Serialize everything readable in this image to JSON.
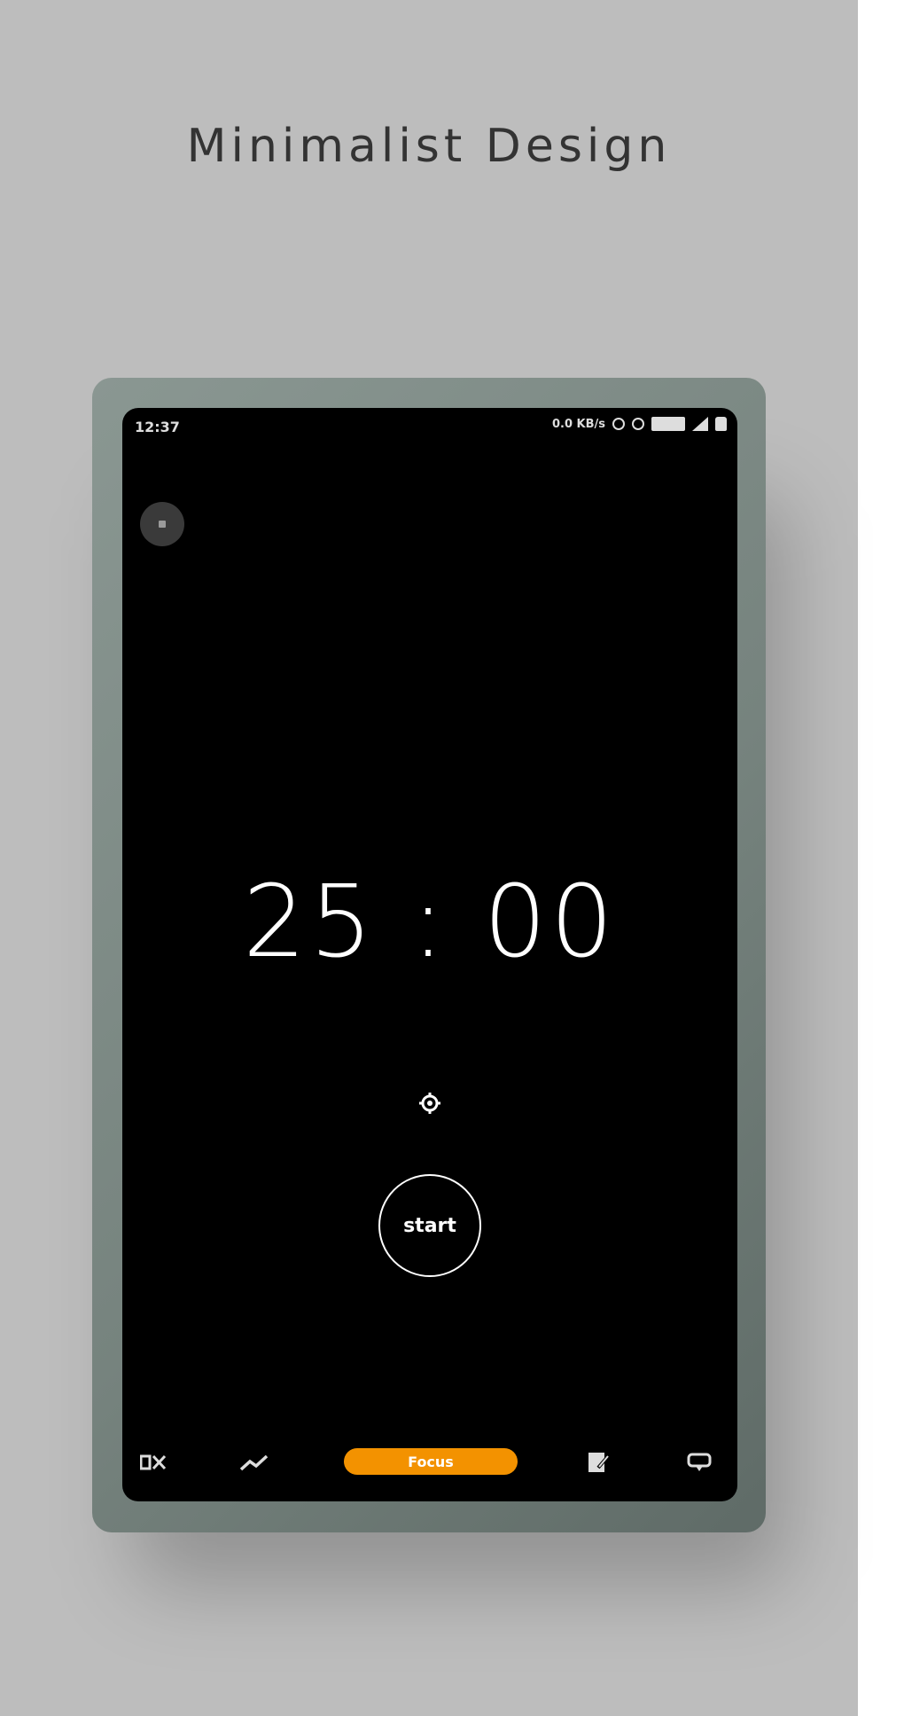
{
  "headline": "Minimalist Design",
  "status_bar": {
    "time": "12:37",
    "speed": "0.0 KB/s",
    "battery_label": ""
  },
  "timer": {
    "display": "25 : 00"
  },
  "controls": {
    "start_label": "start"
  },
  "tabbar": {
    "focus_label": "Focus",
    "icons": [
      "grid-icon",
      "trend-icon",
      "focus-tab",
      "notes-icon",
      "chat-icon"
    ]
  },
  "colors": {
    "background_panel": "#bdbdbd",
    "screen": "#000000",
    "accent": "#f39200",
    "device_frame": "#7d8a85"
  }
}
